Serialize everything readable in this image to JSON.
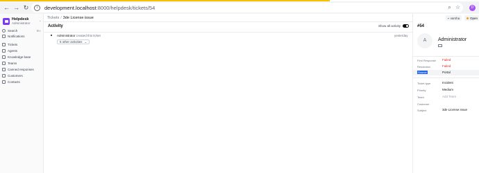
{
  "browser": {
    "url_host": "development.localhost",
    "url_path": ":8000/helpdesk/tickets/54",
    "profile_initial": "D"
  },
  "sidebar": {
    "brand_name": "Helpdesk",
    "brand_role": "Administrator",
    "search_label": "Search",
    "search_shortcut": "⌘K",
    "items": [
      {
        "label": "Notifications"
      },
      {
        "label": "Tickets"
      },
      {
        "label": "Agents"
      },
      {
        "label": "Knowledge base"
      },
      {
        "label": "Teams"
      },
      {
        "label": "Canned responses"
      },
      {
        "label": "Customers"
      },
      {
        "label": "Contacts"
      }
    ]
  },
  "header": {
    "crumb_root": "Tickets",
    "crumb_sep": "/",
    "crumb_current": "3de License issue"
  },
  "activity": {
    "title": "Activity",
    "show_all_label": "Show all activity",
    "entries": [
      {
        "actor": "Administrator",
        "action": "created this ticket",
        "time": "yesterday"
      }
    ],
    "other_activities_label": "5 other activities"
  },
  "details": {
    "user_label": "varsha",
    "status_label": "Open",
    "ticket_number": "#54",
    "contact_initial": "A",
    "contact_name": "Administrator",
    "sla": [
      {
        "label": "First Response",
        "value": "Failed"
      },
      {
        "label": "Resolution",
        "value": "Failed"
      },
      {
        "label": "Source",
        "value": "Portal"
      }
    ],
    "fields": [
      {
        "label": "Ticket type",
        "value": "Incident"
      },
      {
        "label": "Priority",
        "value": "Medium"
      },
      {
        "label": "Team",
        "value": "Add Team"
      },
      {
        "label": "Customer",
        "value": ""
      },
      {
        "label": "Subject",
        "value": "3de License issue"
      }
    ]
  },
  "colors": {
    "accent": "#7c3aed",
    "failed": "#dc2626",
    "progress": "#f6c200",
    "selection": "#2563eb"
  }
}
